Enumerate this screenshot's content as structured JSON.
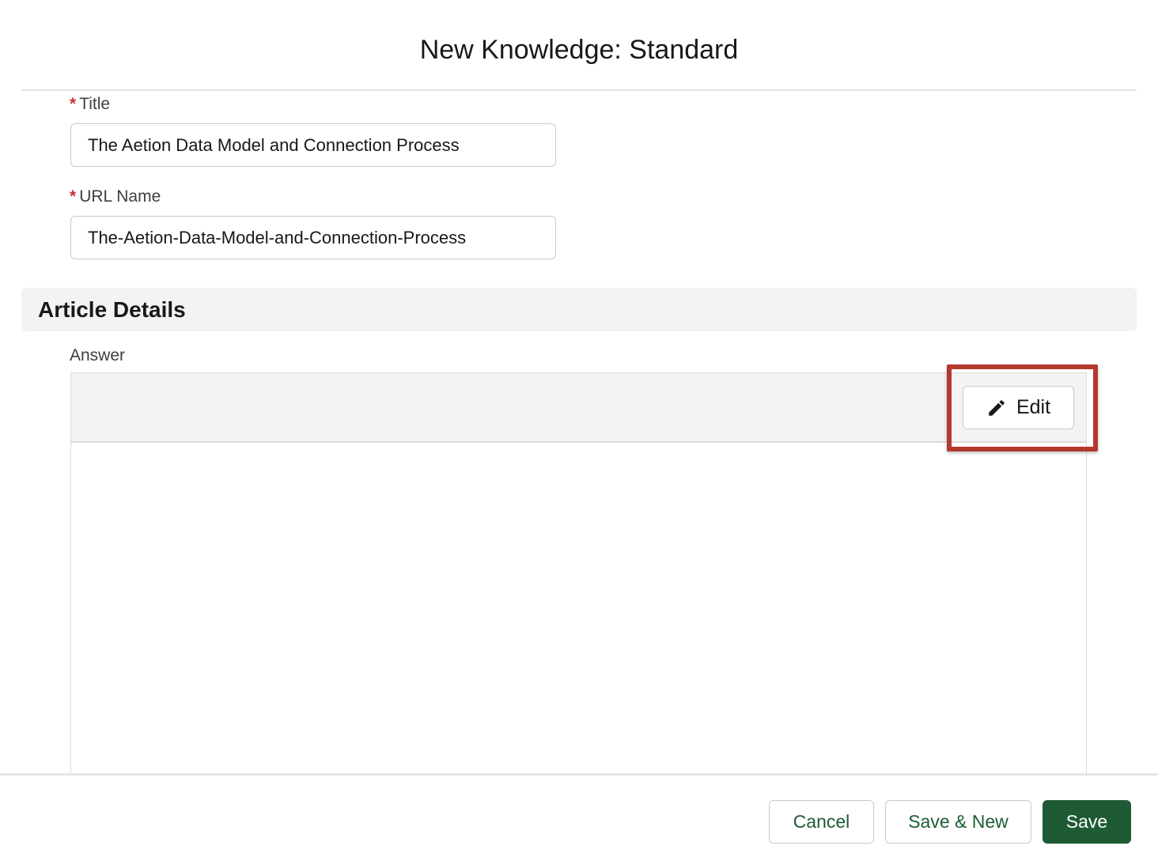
{
  "modal": {
    "title": "New Knowledge: Standard"
  },
  "fields": {
    "title": {
      "label": "Title",
      "required_marker": "*",
      "value": "The Aetion Data Model and Connection Process"
    },
    "url_name": {
      "label": "URL Name",
      "required_marker": "*",
      "value": "The-Aetion-Data-Model-and-Connection-Process"
    }
  },
  "section": {
    "title": "Article Details"
  },
  "answer": {
    "label": "Answer",
    "edit_label": "Edit",
    "edit_icon": "pencil-icon"
  },
  "highlight_color": "#b5382e",
  "footer": {
    "cancel_label": "Cancel",
    "save_new_label": "Save & New",
    "save_label": "Save",
    "brand_color": "#1e5b35"
  }
}
